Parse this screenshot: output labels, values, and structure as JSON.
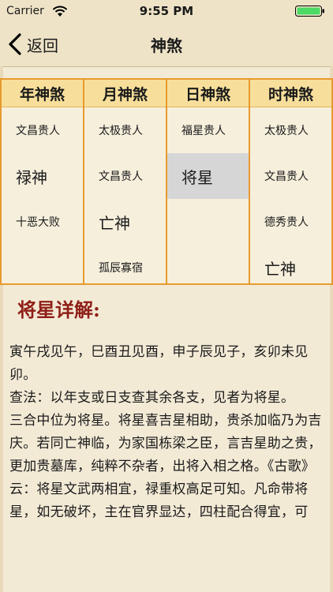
{
  "status": {
    "carrier": "Carrier",
    "time": "9:55 PM"
  },
  "nav": {
    "back_label": "返回",
    "title": "神煞"
  },
  "columns": [
    {
      "header": "年神煞",
      "cells": [
        "文昌贵人",
        "禄神",
        "十恶大败",
        ""
      ],
      "sizes": [
        "small",
        "big",
        "small",
        "small"
      ]
    },
    {
      "header": "月神煞",
      "cells": [
        "太极贵人",
        "文昌贵人",
        "亡神",
        "孤辰寡宿"
      ],
      "sizes": [
        "small",
        "small",
        "big",
        "small"
      ]
    },
    {
      "header": "日神煞",
      "cells": [
        "福星贵人",
        "将星",
        "",
        ""
      ],
      "sizes": [
        "small",
        "big",
        "small",
        "small"
      ]
    },
    {
      "header": "时神煞",
      "cells": [
        "太极贵人",
        "文昌贵人",
        "德秀贵人",
        "亡神"
      ],
      "sizes": [
        "small",
        "small",
        "small",
        "big"
      ]
    }
  ],
  "selected": {
    "column": 2,
    "row": 1
  },
  "detail": {
    "title": "将星详解:",
    "paragraphs": [
      "寅午戌见午，巳酉丑见酉，申子辰见子，亥卯未见卯。",
      "查法：以年支或日支查其余各支，见者为将星。",
      "三合中位为将星。将星喜吉星相助，贵杀加临乃为吉庆。若同亡神临，为家国栋梁之臣，言吉星助之贵，更加贵墓库，纯粹不杂者，出将入相之格。《古歌》云：将星文武两相宜，禄重权高足可知。凡命带将星，如无破坏，主在官界显达，四柱配合得宜，可"
    ]
  }
}
